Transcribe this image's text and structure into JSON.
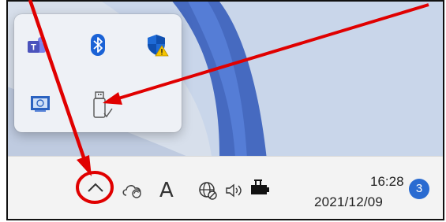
{
  "tray_flyout": {
    "icons": [
      {
        "name": "teams-icon"
      },
      {
        "name": "bluetooth-icon"
      },
      {
        "name": "windows-security-warning-icon"
      },
      {
        "name": "display-icon"
      },
      {
        "name": "usb-drive-icon"
      }
    ]
  },
  "taskbar": {
    "icons": [
      "show-hidden-icons-chevron",
      "onedrive-sync-icon",
      "ime-font-icon",
      "network-icon",
      "volume-icon",
      "battery-charging-icon"
    ],
    "ime_label": "A",
    "clock": {
      "time": "16:28",
      "date": "2021/12/09"
    },
    "notification_count": "3"
  },
  "colors": {
    "annotation_red": "#e00000",
    "accent_blue": "#2a6bd1",
    "taskbar_bg": "#f3f3f3",
    "flyout_bg": "#eef1f6"
  }
}
